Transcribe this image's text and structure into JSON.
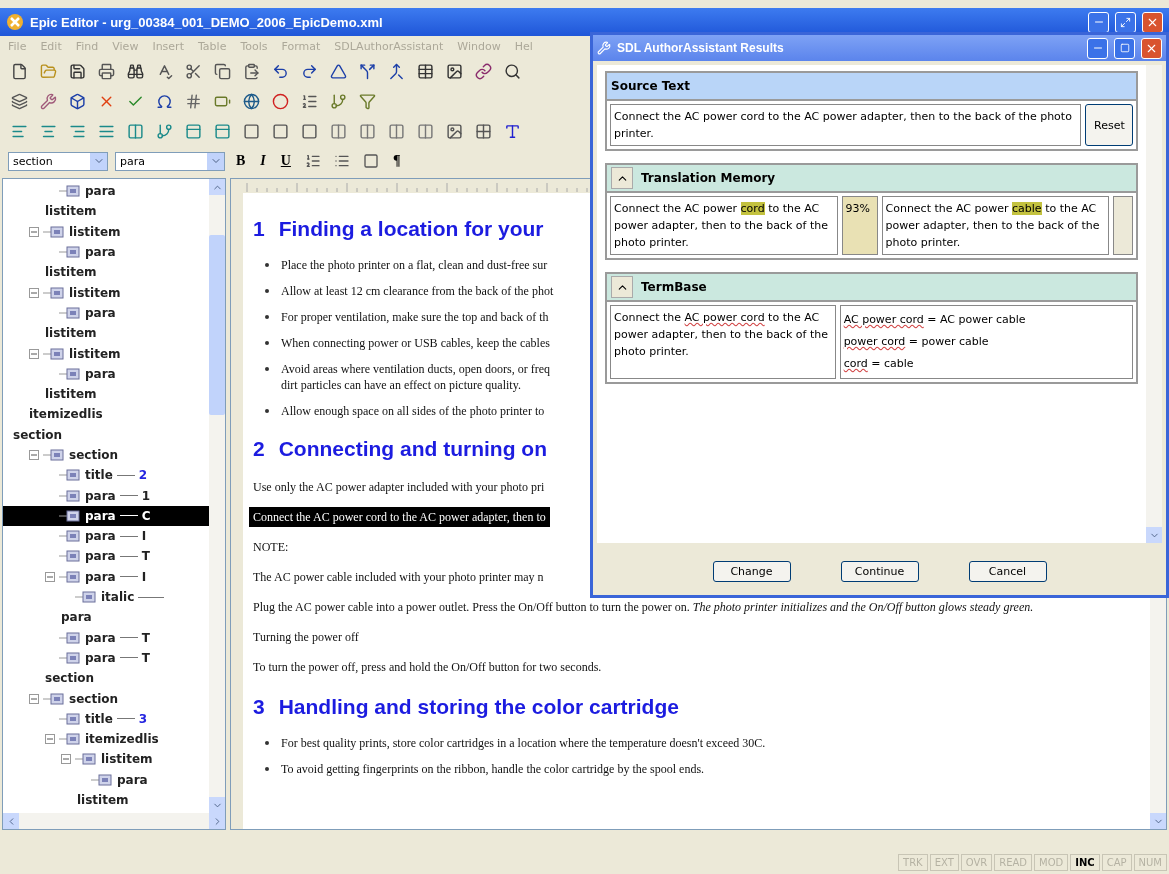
{
  "window": {
    "title": "Epic Editor - urg_00384_001_DEMO_2006_EpicDemo.xml"
  },
  "menu": [
    {
      "label": "File",
      "disabled": true
    },
    {
      "label": "Edit",
      "disabled": true
    },
    {
      "label": "Find",
      "disabled": true
    },
    {
      "label": "View",
      "disabled": true
    },
    {
      "label": "Insert",
      "disabled": true
    },
    {
      "label": "Table",
      "disabled": true
    },
    {
      "label": "Tools",
      "disabled": true
    },
    {
      "label": "Format",
      "disabled": true
    },
    {
      "label": "SDLAuthorAssistant",
      "disabled": true
    },
    {
      "label": "Window",
      "disabled": true
    },
    {
      "label": "Hel",
      "disabled": true
    }
  ],
  "format_bar": {
    "context_select": "section",
    "element_select": "para",
    "bold": "B",
    "italic": "I",
    "underline": "U",
    "pilcrow": "¶"
  },
  "tree": [
    {
      "end_tag": "section",
      "children": [
        {
          "end_tag": "itemizedlis",
          "children": [
            {
              "end_tag": "listitem",
              "children": [
                {
                  "tag": "para",
                  "selected": false
                }
              ]
            },
            {
              "tag": "listitem",
              "selected": false,
              "expanded": true,
              "end_tag": "listitem",
              "children": [
                {
                  "tag": "para",
                  "selected": false
                }
              ]
            },
            {
              "tag": "listitem",
              "selected": false,
              "expanded": true,
              "end_tag": "listitem",
              "children": [
                {
                  "tag": "para",
                  "selected": false
                }
              ]
            },
            {
              "tag": "listitem",
              "selected": false,
              "expanded": true,
              "end_tag": "listitem",
              "children": [
                {
                  "tag": "para",
                  "selected": false
                }
              ]
            }
          ]
        }
      ]
    },
    {
      "tag": "section",
      "selected": false,
      "expanded": true,
      "end_tag": "section",
      "children": [
        {
          "tag": "title",
          "selected": false,
          "preview": {
            "text": "2",
            "kind": "number"
          }
        },
        {
          "tag": "para",
          "selected": false,
          "preview": {
            "text": "1",
            "kind": "text"
          }
        },
        {
          "tag": "para",
          "selected": true,
          "preview": {
            "text": "C",
            "kind": "text"
          }
        },
        {
          "tag": "para",
          "selected": false,
          "preview": {
            "text": "I",
            "kind": "text"
          }
        },
        {
          "tag": "para",
          "selected": false,
          "preview": {
            "text": "T",
            "kind": "text"
          }
        },
        {
          "tag": "para",
          "selected": false,
          "expanded": true,
          "preview": {
            "text": "I",
            "kind": "text"
          },
          "end_tag": "para",
          "children": [
            {
              "tag": "italic",
              "selected": false,
              "preview": {
                "kind": "line"
              }
            }
          ]
        },
        {
          "tag": "para",
          "selected": false,
          "preview": {
            "text": "T",
            "kind": "text"
          }
        },
        {
          "tag": "para",
          "selected": false,
          "preview": {
            "text": "T",
            "kind": "text"
          }
        }
      ]
    },
    {
      "tag": "section",
      "selected": false,
      "expanded": true,
      "children": [
        {
          "tag": "title",
          "selected": false,
          "preview": {
            "text": "3",
            "kind": "number"
          }
        },
        {
          "tag": "itemizedlis",
          "selected": false,
          "expanded": true,
          "children": [
            {
              "tag": "listitem",
              "selected": false,
              "expanded": true,
              "end_tag": "listitem",
              "children": [
                {
                  "tag": "para",
                  "selected": false
                }
              ]
            }
          ]
        }
      ]
    }
  ],
  "document": [
    {
      "kind": "heading",
      "number": "1",
      "text": "Finding a location for your"
    },
    {
      "kind": "bullet",
      "text": "Place the photo printer on a flat, clean and dust-free sur"
    },
    {
      "kind": "bullet",
      "text": "Allow at least 12 cm clearance from the back of the phot"
    },
    {
      "kind": "bullet",
      "text": "For proper ventilation, make sure the top and back of th"
    },
    {
      "kind": "bullet",
      "text": "When connecting power or USB cables, keep the cables"
    },
    {
      "kind": "bullet",
      "text": "Avoid areas where ventilation ducts, open doors, or freq",
      "continuation": "dirt particles can have an effect on picture quality."
    },
    {
      "kind": "bullet",
      "text": "Allow enough space on all sides of the photo printer to"
    },
    {
      "kind": "heading",
      "number": "2",
      "text": "Connecting and turning on"
    },
    {
      "kind": "para",
      "selected": false,
      "text": "Use only the AC power adapter included with your photo pri"
    },
    {
      "kind": "para",
      "selected": true,
      "text": "Connect the AC power cord to the AC power adapter, then to"
    },
    {
      "kind": "para",
      "selected": false,
      "text": "NOTE:"
    },
    {
      "kind": "para",
      "selected": false,
      "text": "The AC power cable included with your photo printer may n"
    },
    {
      "kind": "para",
      "selected": false,
      "text": "Plug the AC power cable into a power outlet. Press the On/Off button to turn the power on. *The photo printer initializes and the On/Off button glows steady green.*"
    },
    {
      "kind": "para",
      "selected": false,
      "text": "Turning the power off"
    },
    {
      "kind": "para",
      "selected": false,
      "text": "To turn the power off, press and hold the On/Off button for two seconds."
    },
    {
      "kind": "heading",
      "number": "3",
      "text": "Handling and storing the color cartridge"
    },
    {
      "kind": "bullet",
      "text": "For best quality prints, store color cartridges in a location where the temperature doesn't exceed 30C."
    },
    {
      "kind": "bullet",
      "text": "To avoid getting fingerprints on the ribbon, handle the color cartridge by the spool ends."
    }
  ],
  "dialog": {
    "title": "SDL AuthorAssistant Results",
    "source": {
      "header": "Source Text",
      "text": "Connect the AC power cord to the AC power adapter, then to the back of the photo printer.",
      "reset": "Reset"
    },
    "memory": {
      "header": "Translation Memory",
      "expanded": true,
      "source_parts": [
        {
          "text": "Connect the AC power ",
          "highlight": false
        },
        {
          "text": "cord",
          "highlight": true
        },
        {
          "text": " to the AC power adapter, then to the back of the photo printer.",
          "highlight": false
        }
      ],
      "score": "93%",
      "target_parts": [
        {
          "text": "Connect the AC power ",
          "highlight": false
        },
        {
          "text": "cable",
          "highlight": true
        },
        {
          "text": " to the AC power adapter, then to the back of the photo printer.",
          "highlight": false
        }
      ]
    },
    "termbase": {
      "header": "TermBase",
      "expanded": true,
      "source_parts": [
        {
          "text": "Connect the ",
          "flagged": false
        },
        {
          "text": "AC power cord",
          "flagged": true
        },
        {
          "text": " to the AC power adapter, then to the back of the photo printer.",
          "flagged": false
        }
      ],
      "terms": [
        {
          "term": "AC power cord",
          "equals": "=",
          "translation": "AC power cable"
        },
        {
          "term": "power cord",
          "equals": "=",
          "translation": "power cable"
        },
        {
          "term": "cord",
          "equals": "=",
          "translation": "cable"
        }
      ]
    },
    "buttons": [
      "Change",
      "Continue",
      "Cancel"
    ]
  },
  "status_bar": [
    {
      "label": "TRK",
      "on": false
    },
    {
      "label": "EXT",
      "on": false
    },
    {
      "label": "OVR",
      "on": false
    },
    {
      "label": "READ",
      "on": false
    },
    {
      "label": "MOD",
      "on": false
    },
    {
      "label": "INC",
      "on": true
    },
    {
      "label": "CAP",
      "on": false
    },
    {
      "label": "NUM",
      "on": false
    }
  ]
}
